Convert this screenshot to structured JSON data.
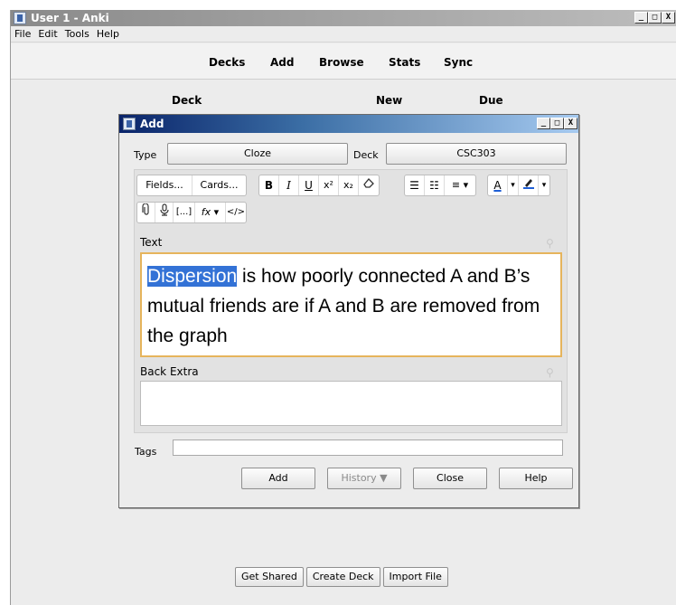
{
  "window": {
    "title": "User 1 - Anki",
    "controls": [
      "_",
      "□",
      "X"
    ]
  },
  "menu": [
    "File",
    "Edit",
    "Tools",
    "Help"
  ],
  "toolbar": [
    "Decks",
    "Add",
    "Browse",
    "Stats",
    "Sync"
  ],
  "deck_table": {
    "headers": [
      "Deck",
      "New",
      "Due"
    ]
  },
  "bottom_buttons": [
    "Get Shared",
    "Create Deck",
    "Import File"
  ],
  "add_dialog": {
    "title": "Add",
    "controls": [
      "_",
      "□",
      "X"
    ],
    "type_label": "Type",
    "type_value": "Cloze",
    "deck_label": "Deck",
    "deck_value": "CSC303",
    "editor_buttons": {
      "fields": "Fields...",
      "cards": "Cards...",
      "bold": "B",
      "italic": "I",
      "underline": "U",
      "superscript": "x²",
      "subscript": "x₂",
      "eraser": "⌫",
      "bullet_list": "☰",
      "numbered_list": "☷",
      "align": "≡ ▾",
      "text_color": "A",
      "highlight": "▾",
      "attach": "📎",
      "record": "🎙",
      "cloze": "[...]",
      "math": "fx ▾",
      "html": "</>"
    },
    "fields": [
      {
        "label": "Text",
        "highlighted": "Dispersion",
        "content": " is how poorly connected A and B’s mutual friends are if A and B are removed from the graph"
      },
      {
        "label": "Back Extra",
        "content": ""
      }
    ],
    "tags_label": "Tags",
    "tags_value": "",
    "buttons": {
      "add": "Add",
      "history": "History ▼",
      "close": "Close",
      "help": "Help"
    }
  },
  "colors": {
    "dialog_title_start": "#0a246a",
    "dialog_title_end": "#a6caf0",
    "field_focus_border": "#e6b45c",
    "selection": "#3372d6"
  },
  "icons": [
    "anki-icon",
    "pin-icon",
    "paperclip-icon",
    "microphone-icon",
    "eraser-icon",
    "text-color-icon",
    "highlight-icon"
  ]
}
